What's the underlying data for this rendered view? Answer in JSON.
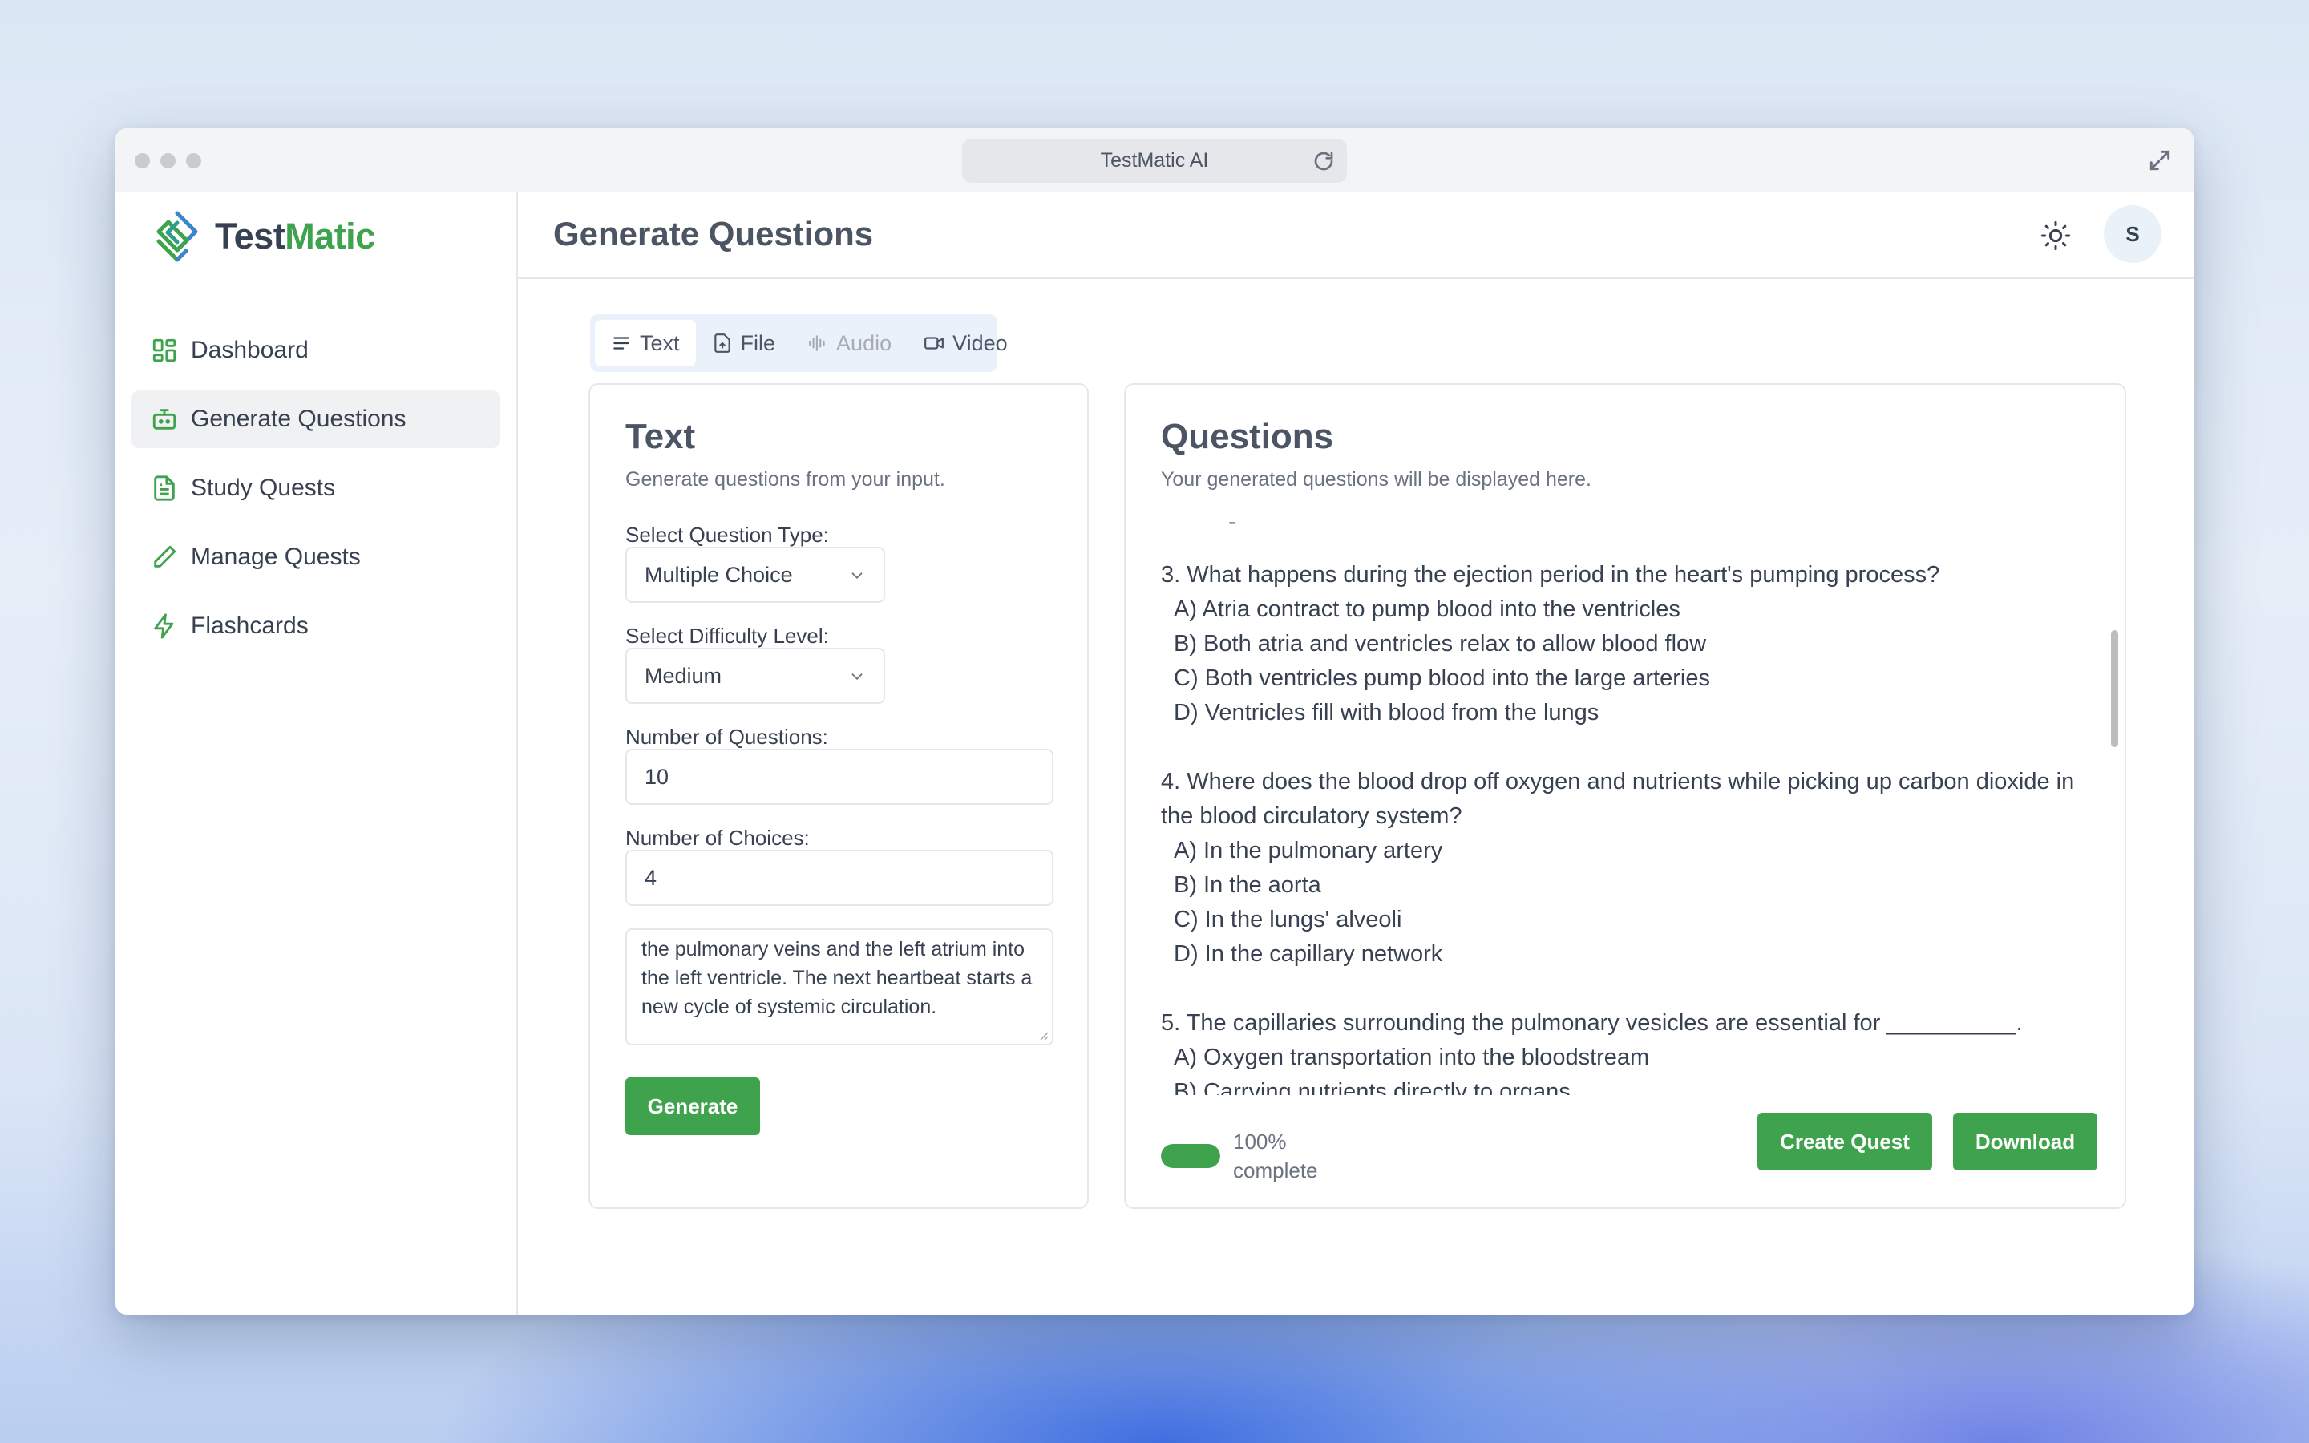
{
  "window": {
    "url_title": "TestMatic AI"
  },
  "brand": {
    "name_part1": "Test",
    "name_part2": "Matic",
    "accent_color": "#3fa34d"
  },
  "sidebar": {
    "items": [
      {
        "label": "Dashboard",
        "icon": "dashboard-icon"
      },
      {
        "label": "Generate Questions",
        "icon": "robot-icon",
        "active": true
      },
      {
        "label": "Study Quests",
        "icon": "document-icon"
      },
      {
        "label": "Manage Quests",
        "icon": "pencil-icon"
      },
      {
        "label": "Flashcards",
        "icon": "lightning-icon"
      }
    ]
  },
  "header": {
    "title": "Generate Questions",
    "avatar_initial": "S",
    "theme_icon": "sun-icon"
  },
  "tabs": [
    {
      "label": "Text",
      "icon": "text-lines-icon",
      "active": true
    },
    {
      "label": "File",
      "icon": "file-upload-icon"
    },
    {
      "label": "Audio",
      "icon": "audio-wave-icon",
      "disabled": true
    },
    {
      "label": "Video",
      "icon": "video-camera-icon"
    }
  ],
  "input_card": {
    "title": "Text",
    "subtitle": "Generate questions from your input.",
    "question_type_label": "Select Question Type:",
    "question_type_value": "Multiple Choice",
    "difficulty_label": "Select Difficulty Level:",
    "difficulty_value": "Medium",
    "num_questions_label": "Number of Questions:",
    "num_questions_value": "10",
    "num_choices_label": "Number of Choices:",
    "num_choices_value": "4",
    "text_value": "the pulmonary veins and the left atrium into the left ventricle. The next heartbeat starts a new cycle of systemic circulation.",
    "generate_label": "Generate"
  },
  "questions_card": {
    "title": "Questions",
    "subtitle": "Your generated questions will be displayed here.",
    "leading_dash": "-",
    "questions": [
      {
        "text": "3. What happens during the ejection period in the heart's pumping process?",
        "options": [
          "A) Atria contract to pump blood into the ventricles",
          "B) Both atria and ventricles relax to allow blood flow",
          "C) Both ventricles pump blood into the large arteries",
          "D) Ventricles fill with blood from the lungs"
        ]
      },
      {
        "text": "4. Where does the blood drop off oxygen and nutrients while picking up carbon dioxide in the blood circulatory system?",
        "options": [
          "A) In the pulmonary artery",
          "B) In the aorta",
          "C) In the lungs' alveoli",
          "D) In the capillary network"
        ]
      },
      {
        "text": "5. The capillaries surrounding the pulmonary vesicles are essential for __________.",
        "options": [
          "A) Oxygen transportation into the bloodstream",
          "B) Carrying nutrients directly to organs"
        ]
      }
    ],
    "progress_value": 100,
    "progress_text": "100% complete",
    "create_quest_label": "Create Quest",
    "download_label": "Download"
  }
}
